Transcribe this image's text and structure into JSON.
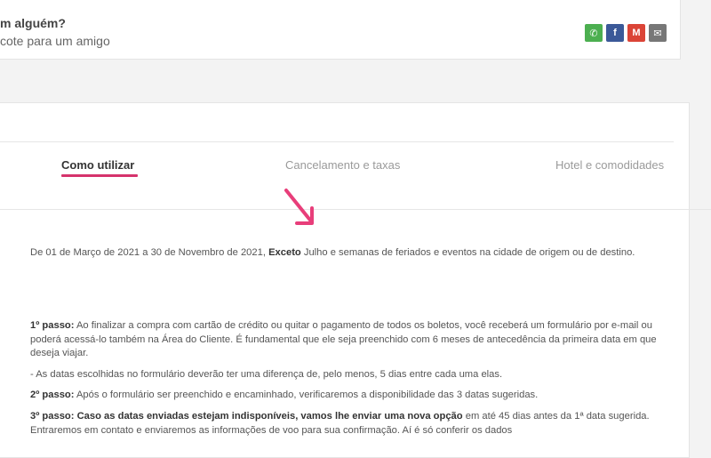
{
  "share": {
    "title": "m alguém?",
    "subtitle": "cote para um amigo",
    "icons": [
      {
        "name": "whatsapp-icon",
        "glyph": "✆"
      },
      {
        "name": "facebook-icon",
        "glyph": "f"
      },
      {
        "name": "gmail-icon",
        "glyph": "M"
      },
      {
        "name": "email-icon",
        "glyph": "✉"
      }
    ]
  },
  "tabs": [
    {
      "label": "Como utilizar",
      "active": true
    },
    {
      "label": "Cancelamento e taxas",
      "active": false
    },
    {
      "label": "Hotel e comodidades",
      "active": false
    }
  ],
  "content": {
    "period_pre": "De 01 de Março de 2021 a 30 de Novembro de 2021, ",
    "period_bold": "Exceto",
    "period_post": " Julho e semanas de feriados e eventos na cidade de origem ou de destino.",
    "step1_label": "1º passo:",
    "step1_text": " Ao finalizar a compra com cartão de crédito ou quitar o pagamento de todos os boletos, você receberá um formulário por e-mail ou poderá acessá-lo também na Área do Cliente. É fundamental que ele seja preenchido com 6 meses de antecedência da primeira data em que deseja viajar.",
    "note": "- As datas escolhidas no formulário deverão ter uma diferença de, pelo menos, 5 dias entre cada uma elas.",
    "step2_label": "2º passo:",
    "step2_text": " Após o formulário ser preenchido e encaminhado, verificaremos a disponibilidade das 3 datas sugeridas.",
    "step3_label": "3º passo:",
    "step3_bold": "  Caso as datas enviadas estejam indisponíveis, vamos lhe enviar uma nova opção",
    "step3_text": " em até 45 dias antes da 1ª data sugerida. Entraremos em contato e enviaremos as informações de voo para sua confirmação. Aí é só conferir os dados"
  }
}
